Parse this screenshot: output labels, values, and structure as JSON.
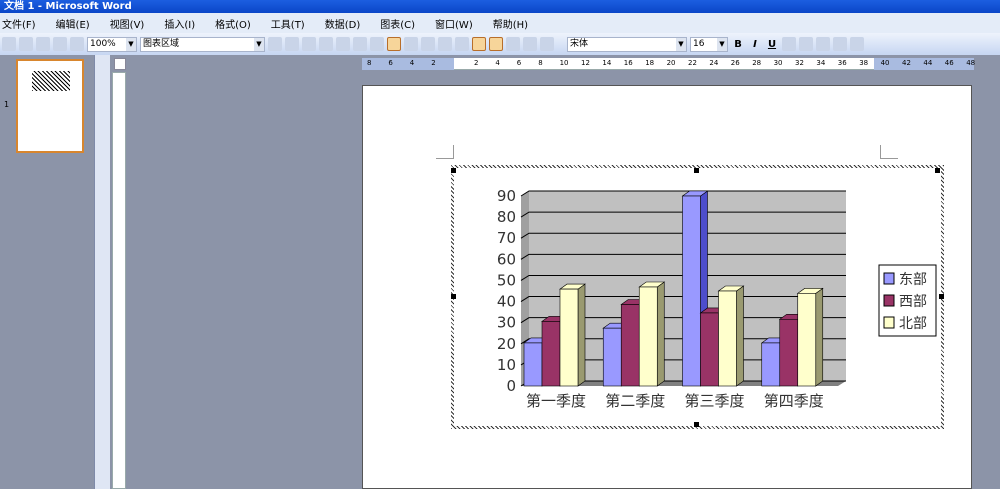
{
  "window": {
    "title": "文档 1 - Microsoft Word"
  },
  "menu": [
    "文件(F)",
    "编辑(E)",
    "视图(V)",
    "插入(I)",
    "格式(O)",
    "工具(T)",
    "数据(D)",
    "图表(C)",
    "窗口(W)",
    "帮助(H)"
  ],
  "toolbar": {
    "zoom": "100%",
    "chart_object": "图表区域",
    "font": "宋体",
    "font_size": "16",
    "bold": "B",
    "italic": "I",
    "underline": "U"
  },
  "ruler": {
    "ticks": [
      "8",
      "6",
      "4",
      "2",
      "",
      "2",
      "4",
      "6",
      "8",
      "10",
      "12",
      "14",
      "16",
      "18",
      "20",
      "22",
      "24",
      "26",
      "28",
      "30",
      "32",
      "34",
      "36",
      "38",
      "40",
      "42",
      "44",
      "46",
      "48"
    ]
  },
  "thumbnail": {
    "page_number": "1"
  },
  "chart_data": {
    "type": "bar",
    "subtype": "3d-clustered-column",
    "categories": [
      "第一季度",
      "第二季度",
      "第三季度",
      "第四季度"
    ],
    "series": [
      {
        "name": "东部",
        "values": [
          20.4,
          27.4,
          90,
          20.4
        ],
        "color": "#9999ff"
      },
      {
        "name": "西部",
        "values": [
          30.6,
          38.6,
          34.6,
          31.6
        ],
        "color": "#993366"
      },
      {
        "name": "北部",
        "values": [
          45.9,
          46.9,
          45,
          43.9
        ],
        "color": "#ffffcc"
      }
    ],
    "ylim": [
      0,
      90
    ],
    "yticks": [
      "0",
      "10",
      "20",
      "30",
      "40",
      "50",
      "60",
      "70",
      "80",
      "90"
    ],
    "grid": true,
    "legend": "right"
  }
}
